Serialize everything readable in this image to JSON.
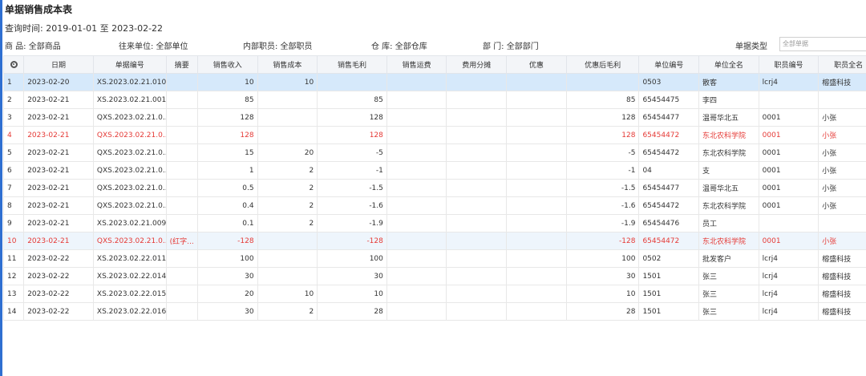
{
  "title": "单据销售成本表",
  "query_time": "查询时间: 2019-01-01 至 2023-02-22",
  "filters": {
    "product": "商 品: 全部商品",
    "partner": "往来单位: 全部单位",
    "employee": "内部职员: 全部职员",
    "warehouse": "仓 库: 全部仓库",
    "department": "部 门: 全部部门",
    "doc_type_label": "单据类型",
    "doc_type_placeholder": "全部单据"
  },
  "columns": [
    "日期",
    "单据编号",
    "摘要",
    "销售收入",
    "销售成本",
    "销售毛利",
    "销售运费",
    "费用分摊",
    "优惠",
    "优惠后毛利",
    "单位编号",
    "单位全名",
    "职员编号",
    "职员全名"
  ],
  "rows": [
    {
      "idx": "1",
      "date": "2023-02-20",
      "doc_no": "XS.2023.02.21.010",
      "summary": "",
      "revenue": "10",
      "cost": "10",
      "gross": "",
      "freight": "",
      "alloc": "",
      "discount": "",
      "net": "",
      "unit_no": "0503",
      "unit_name": "散客",
      "emp_no": "lcrj4",
      "emp_name": "榕盛科技"
    },
    {
      "idx": "2",
      "date": "2023-02-21",
      "doc_no": "XS.2023.02.21.001",
      "summary": "",
      "revenue": "85",
      "cost": "",
      "gross": "85",
      "freight": "",
      "alloc": "",
      "discount": "",
      "net": "85",
      "unit_no": "65454475",
      "unit_name": "李四",
      "emp_no": "",
      "emp_name": ""
    },
    {
      "idx": "3",
      "date": "2023-02-21",
      "doc_no": "QXS.2023.02.21.0...",
      "summary": "",
      "revenue": "128",
      "cost": "",
      "gross": "128",
      "freight": "",
      "alloc": "",
      "discount": "",
      "net": "128",
      "unit_no": "65454477",
      "unit_name": "温哥华北五",
      "emp_no": "0001",
      "emp_name": "小张"
    },
    {
      "idx": "4",
      "date": "2023-02-21",
      "doc_no": "QXS.2023.02.21.0...",
      "summary": "",
      "revenue": "128",
      "cost": "",
      "gross": "128",
      "freight": "",
      "alloc": "",
      "discount": "",
      "net": "128",
      "unit_no": "65454472",
      "unit_name": "东北农科学院",
      "emp_no": "0001",
      "emp_name": "小张"
    },
    {
      "idx": "5",
      "date": "2023-02-21",
      "doc_no": "QXS.2023.02.21.0...",
      "summary": "",
      "revenue": "15",
      "cost": "20",
      "gross": "-5",
      "freight": "",
      "alloc": "",
      "discount": "",
      "net": "-5",
      "unit_no": "65454472",
      "unit_name": "东北农科学院",
      "emp_no": "0001",
      "emp_name": "小张"
    },
    {
      "idx": "6",
      "date": "2023-02-21",
      "doc_no": "QXS.2023.02.21.0...",
      "summary": "",
      "revenue": "1",
      "cost": "2",
      "gross": "-1",
      "freight": "",
      "alloc": "",
      "discount": "",
      "net": "-1",
      "unit_no": "04",
      "unit_name": "支",
      "emp_no": "0001",
      "emp_name": "小张"
    },
    {
      "idx": "7",
      "date": "2023-02-21",
      "doc_no": "QXS.2023.02.21.0...",
      "summary": "",
      "revenue": "0.5",
      "cost": "2",
      "gross": "-1.5",
      "freight": "",
      "alloc": "",
      "discount": "",
      "net": "-1.5",
      "unit_no": "65454477",
      "unit_name": "温哥华北五",
      "emp_no": "0001",
      "emp_name": "小张"
    },
    {
      "idx": "8",
      "date": "2023-02-21",
      "doc_no": "QXS.2023.02.21.0...",
      "summary": "",
      "revenue": "0.4",
      "cost": "2",
      "gross": "-1.6",
      "freight": "",
      "alloc": "",
      "discount": "",
      "net": "-1.6",
      "unit_no": "65454472",
      "unit_name": "东北农科学院",
      "emp_no": "0001",
      "emp_name": "小张"
    },
    {
      "idx": "9",
      "date": "2023-02-21",
      "doc_no": "XS.2023.02.21.009",
      "summary": "",
      "revenue": "0.1",
      "cost": "2",
      "gross": "-1.9",
      "freight": "",
      "alloc": "",
      "discount": "",
      "net": "-1.9",
      "unit_no": "65454476",
      "unit_name": "员工",
      "emp_no": "",
      "emp_name": ""
    },
    {
      "idx": "10",
      "date": "2023-02-21",
      "doc_no": "QXS.2023.02.21.0...",
      "summary": "(红字...",
      "revenue": "-128",
      "cost": "",
      "gross": "-128",
      "freight": "",
      "alloc": "",
      "discount": "",
      "net": "-128",
      "unit_no": "65454472",
      "unit_name": "东北农科学院",
      "emp_no": "0001",
      "emp_name": "小张"
    },
    {
      "idx": "11",
      "date": "2023-02-22",
      "doc_no": "XS.2023.02.22.011",
      "summary": "",
      "revenue": "100",
      "cost": "",
      "gross": "100",
      "freight": "",
      "alloc": "",
      "discount": "",
      "net": "100",
      "unit_no": "0502",
      "unit_name": "批发客户",
      "emp_no": "lcrj4",
      "emp_name": "榕盛科技"
    },
    {
      "idx": "12",
      "date": "2023-02-22",
      "doc_no": "XS.2023.02.22.014",
      "summary": "",
      "revenue": "30",
      "cost": "",
      "gross": "30",
      "freight": "",
      "alloc": "",
      "discount": "",
      "net": "30",
      "unit_no": "1501",
      "unit_name": "张三",
      "emp_no": "lcrj4",
      "emp_name": "榕盛科技"
    },
    {
      "idx": "13",
      "date": "2023-02-22",
      "doc_no": "XS.2023.02.22.015",
      "summary": "",
      "revenue": "20",
      "cost": "10",
      "gross": "10",
      "freight": "",
      "alloc": "",
      "discount": "",
      "net": "10",
      "unit_no": "1501",
      "unit_name": "张三",
      "emp_no": "lcrj4",
      "emp_name": "榕盛科技"
    },
    {
      "idx": "14",
      "date": "2023-02-22",
      "doc_no": "XS.2023.02.22.016",
      "summary": "",
      "revenue": "30",
      "cost": "2",
      "gross": "28",
      "freight": "",
      "alloc": "",
      "discount": "",
      "net": "28",
      "unit_no": "1501",
      "unit_name": "张三",
      "emp_no": "lcrj4",
      "emp_name": "榕盛科技"
    }
  ],
  "red_rows": [
    "4",
    "10"
  ],
  "selected_row": "1",
  "colors": {
    "accent": "#2f6fd1",
    "red": "#e53935",
    "selected": "#d6e9fb"
  }
}
